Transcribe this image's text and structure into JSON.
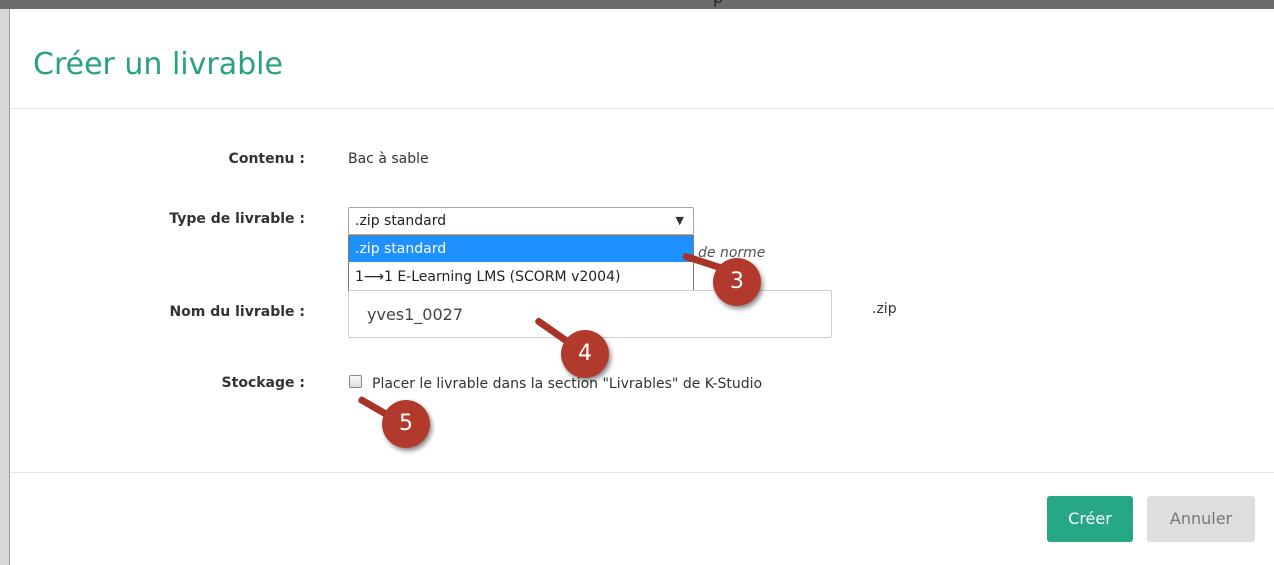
{
  "top_fragment": "p",
  "modal": {
    "title": "Créer un livrable",
    "fields": {
      "content_label": "Contenu :",
      "content_value": "Bac à sable",
      "type_label": "Type de livrable :",
      "type_selected": ".zip standard",
      "type_options": [
        ".zip standard",
        "1⟶1 E-Learning LMS (SCORM v2004)"
      ],
      "type_hint": "de norme",
      "name_label": "Nom du livrable :",
      "name_value": "yves1_0027",
      "name_suffix": ".zip",
      "storage_label": "Stockage :",
      "storage_checkbox_label": "Placer le livrable dans la section \"Livrables\" de K-Studio",
      "storage_checked": false
    },
    "buttons": {
      "create": "Créer",
      "cancel": "Annuler"
    }
  },
  "callouts": [
    {
      "number": "3"
    },
    {
      "number": "4"
    },
    {
      "number": "5"
    }
  ],
  "colors": {
    "accent": "#2aa282",
    "primary_button": "#26a785",
    "secondary_button": "#dedede",
    "callout": "#b23a2c",
    "dropdown_highlight": "#1e90ff"
  }
}
